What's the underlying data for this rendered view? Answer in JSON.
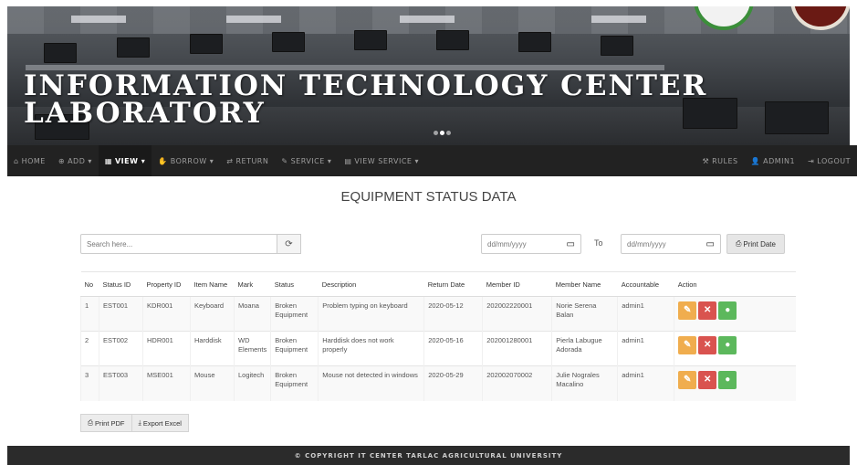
{
  "banner": {
    "title": "INFORMATION TECHNOLOGY CENTER LABORATORY"
  },
  "navbar": {
    "left": [
      {
        "icon": "home-icon",
        "glyph": "⌂",
        "label": "HOME",
        "active": false
      },
      {
        "icon": "plus-circle-icon",
        "glyph": "⊕",
        "label": "ADD ▾",
        "active": false
      },
      {
        "icon": "list-icon",
        "glyph": "▦",
        "label": "VIEW ▾",
        "active": true
      },
      {
        "icon": "hand-icon",
        "glyph": "✋",
        "label": "BORROW ▾",
        "active": false
      },
      {
        "icon": "return-icon",
        "glyph": "⇄",
        "label": "RETURN",
        "active": false
      },
      {
        "icon": "wrench-icon",
        "glyph": "✎",
        "label": "SERVICE ▾",
        "active": false
      },
      {
        "icon": "view-service-icon",
        "glyph": "▤",
        "label": "VIEW SERVICE ▾",
        "active": false
      }
    ],
    "right": [
      {
        "icon": "rules-icon",
        "glyph": "⚒",
        "label": "RULES"
      },
      {
        "icon": "user-icon",
        "glyph": "👤",
        "label": "ADMIN1"
      },
      {
        "icon": "logout-icon",
        "glyph": "⇥",
        "label": "LOGOUT"
      }
    ]
  },
  "page": {
    "heading": "EQUIPMENT STATUS DATA"
  },
  "filters": {
    "search_placeholder": "Search here...",
    "date_from_placeholder": "dd/mm/yyyy",
    "to_label": "To",
    "date_to_placeholder": "dd/mm/yyyy",
    "print_date_label": "Print Date"
  },
  "table": {
    "headers": [
      "No",
      "Status ID",
      "Property ID",
      "Item Name",
      "Mark",
      "Status",
      "Description",
      "Return Date",
      "Member ID",
      "Member Name",
      "Accountable",
      "Action"
    ],
    "rows": [
      {
        "no": "1",
        "status_id": "EST001",
        "property_id": "KDR001",
        "item_name": "Keyboard",
        "mark": "Moana",
        "status": "Broken Equipment",
        "description": "Problem typing on keyboard",
        "return_date": "2020-05-12",
        "member_id": "202002220001",
        "member_name": "Norie Serena Balan",
        "accountable": "admin1"
      },
      {
        "no": "2",
        "status_id": "EST002",
        "property_id": "HDR001",
        "item_name": "Harddisk",
        "mark": "WD Elements",
        "status": "Broken Equipment",
        "description": "Harddisk does not work properly",
        "return_date": "2020-05-16",
        "member_id": "202001280001",
        "member_name": "Pierla Labugue Adorada",
        "accountable": "admin1"
      },
      {
        "no": "3",
        "status_id": "EST003",
        "property_id": "MSE001",
        "item_name": "Mouse",
        "mark": "Logitech",
        "status": "Broken Equipment",
        "description": "Mouse not detected in windows",
        "return_date": "2020-05-29",
        "member_id": "202002070002",
        "member_name": "Julie Nograles Macalino",
        "accountable": "admin1"
      }
    ]
  },
  "export": {
    "print_pdf_label": "Print PDF",
    "export_excel_label": "Export Excel"
  },
  "footer": {
    "text": "© COPYRIGHT IT CENTER TARLAC AGRICULTURAL UNIVERSITY"
  },
  "colors": {
    "navbar_bg": "#222222",
    "edit": "#f0ad4e",
    "delete": "#d9534f",
    "view": "#5cb85c"
  }
}
